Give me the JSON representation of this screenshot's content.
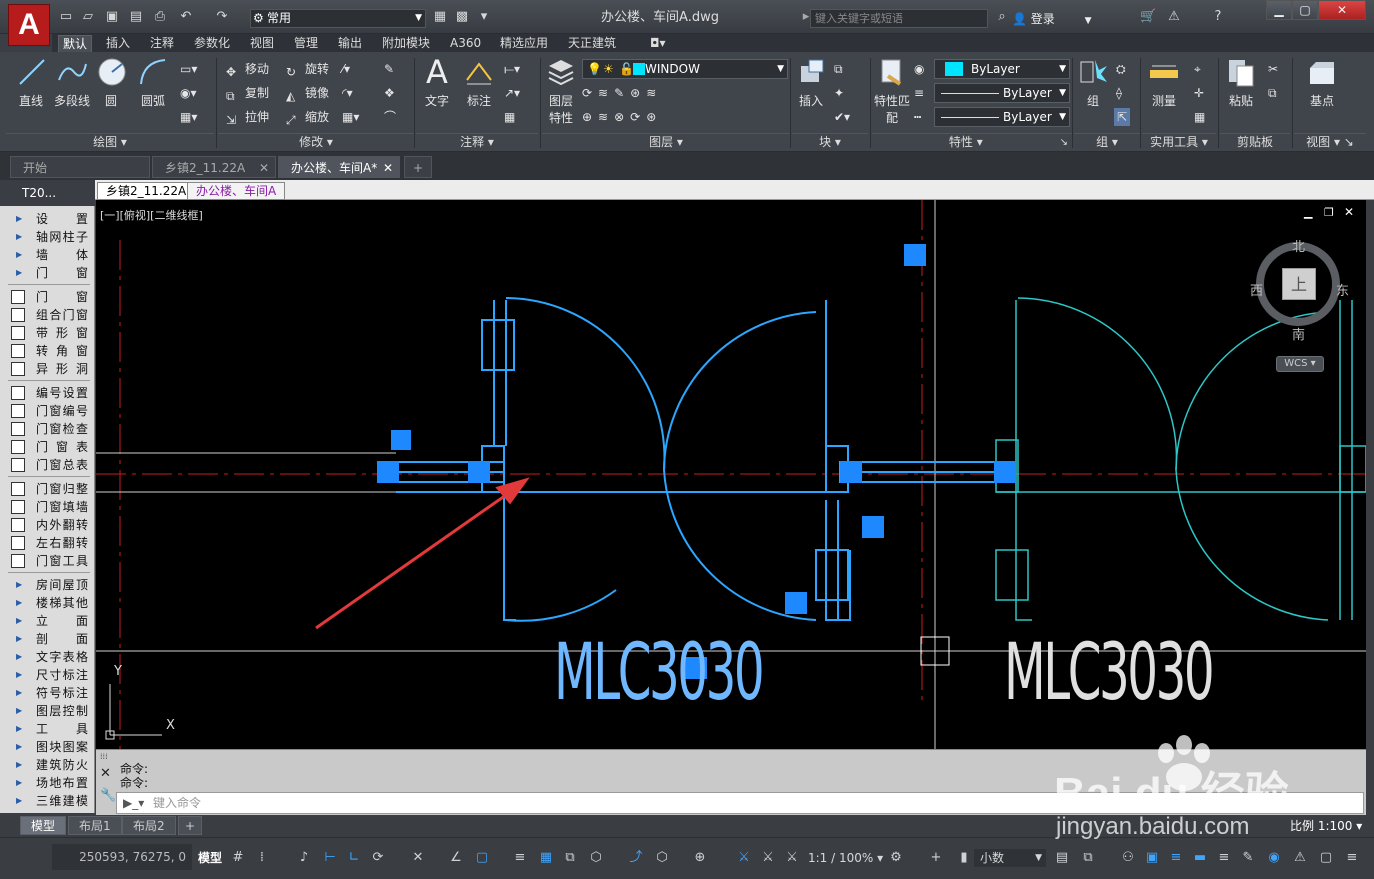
{
  "title_bar": {
    "app_logo": "A",
    "workspace": "常用",
    "doc_title": "办公楼、车间A.dwg",
    "search_placeholder": "键入关键字或短语",
    "login": "登录"
  },
  "ribbon_tabs": [
    "默认",
    "插入",
    "注释",
    "参数化",
    "视图",
    "管理",
    "输出",
    "附加模块",
    "A360",
    "精选应用",
    "天正建筑"
  ],
  "active_ribbon_tab": "默认",
  "draw": {
    "line": "直线",
    "polyline": "多段线",
    "circle": "圆",
    "arc": "圆弧",
    "panel": "绘图"
  },
  "modify": {
    "move": "移动",
    "rotate": "旋转",
    "copy": "复制",
    "mirror": "镜像",
    "stretch": "拉伸",
    "scale": "缩放",
    "panel": "修改"
  },
  "annotation": {
    "text": "文字",
    "dimension": "标注",
    "panel": "注释"
  },
  "layers": {
    "layer_props": "图层特性",
    "current_layer": "WINDOW",
    "panel": "图层"
  },
  "block": {
    "insert": "插入",
    "panel": "块"
  },
  "properties": {
    "match": "特性匹配",
    "color": "ByLayer",
    "linetype": "ByLayer",
    "lineweight": "ByLayer",
    "panel": "特性"
  },
  "groups": {
    "group": "组",
    "panel": "组"
  },
  "utilities": {
    "measure": "测量",
    "panel": "实用工具"
  },
  "clipboard": {
    "paste": "粘贴",
    "panel": "剪贴板"
  },
  "view": {
    "base": "基点",
    "panel": "视图"
  },
  "doc_tabs": [
    "开始",
    "乡镇2_11.22A",
    "办公楼、车间A*"
  ],
  "file_tabs": [
    "乡镇2_11.22A",
    "办公楼、车间A"
  ],
  "palette": {
    "title": "T20...",
    "groups": [
      "设　置",
      "轴网柱子",
      "墙　体",
      "门　窗"
    ],
    "door_tools": [
      "门　窗",
      "组合门窗",
      "带形窗",
      "转角窗",
      "异形洞"
    ],
    "number_tools": [
      "编号设置",
      "门窗编号",
      "门窗检查",
      "门窗表",
      "门窗总表"
    ],
    "edit_tools": [
      "门窗归整",
      "门窗填墙",
      "内外翻转",
      "左右翻转",
      "门窗工具"
    ],
    "more_groups": [
      "房间屋顶",
      "楼梯其他",
      "立　面",
      "剖　面",
      "文字表格",
      "尺寸标注",
      "符号标注",
      "图层控制",
      "工　具",
      "图块图案",
      "建筑防火",
      "场地布置",
      "三维建模"
    ]
  },
  "viewport": {
    "label": "[一][俯视][二维线框]",
    "tag_left": "MLC3030",
    "tag_right": "MLC3030",
    "viewcube": {
      "north": "北",
      "south": "南",
      "east": "东",
      "west": "西",
      "top": "上",
      "wcs": "WCS"
    },
    "ucs_x": "X",
    "ucs_y": "Y"
  },
  "command": {
    "line1": "命令:",
    "line2": "命令:",
    "placeholder": "键入命令"
  },
  "layout_tabs": [
    "模型",
    "布局1",
    "布局2"
  ],
  "status": {
    "coords": "250593, 76275, 0",
    "model": "模型",
    "scale": "1:1 / 100%",
    "units": "小数",
    "ratio": "比例 1:100"
  },
  "watermark": {
    "brand": "Bai du 经验",
    "url": "jingyan.baidu.com"
  },
  "colors": {
    "accent_blue": "#1e88ff",
    "door_blue": "#2ca6ff",
    "door_cyan": "#2ec6c6",
    "red_axis": "#c81e1e"
  }
}
